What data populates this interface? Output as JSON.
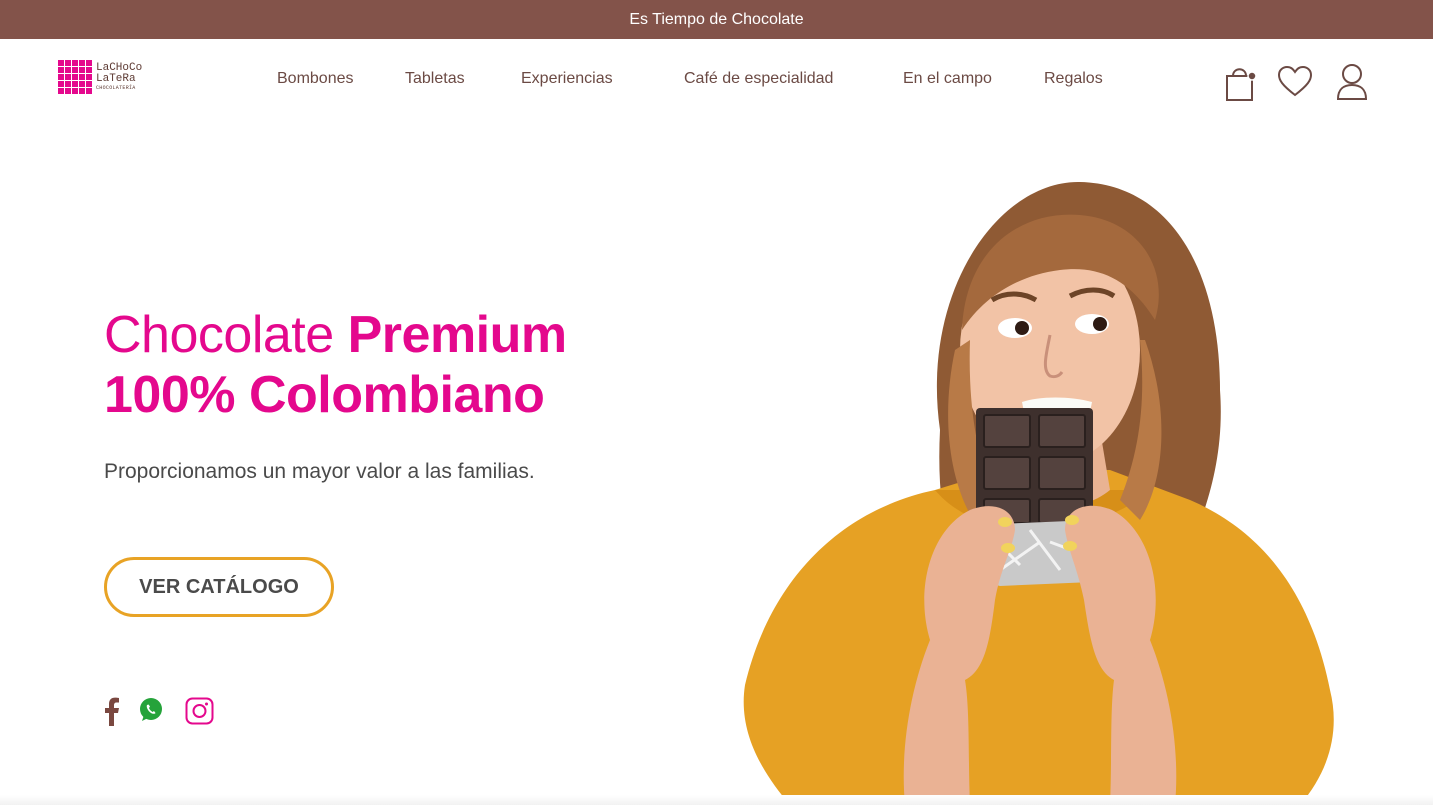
{
  "announcement": {
    "text": "Es Tiempo de Chocolate"
  },
  "logo": {
    "line1": "LaCHoCo",
    "line2": "LaTeRa",
    "line3": "CHOCOLATERÍA"
  },
  "nav": {
    "items": [
      {
        "label": "Bombones"
      },
      {
        "label": "Tabletas"
      },
      {
        "label": "Experiencias"
      },
      {
        "label": "Café de especialidad"
      },
      {
        "label": "En el campo"
      },
      {
        "label": "Regalos"
      }
    ]
  },
  "header_icons": [
    "shopping-bag-icon",
    "heart-icon",
    "user-icon"
  ],
  "hero": {
    "title_light": "Chocolate ",
    "title_bold_1": "Premium",
    "title_bold_2": "100% Colombiano",
    "subtitle": "Proporcionamos un mayor valor a las familias.",
    "cta_label": "VER CATÁLOGO"
  },
  "social": [
    "facebook-icon",
    "whatsapp-icon",
    "instagram-icon"
  ],
  "colors": {
    "topbar": "#83534a",
    "brand_pink": "#e4088d",
    "cta_border": "#e8a325",
    "nav_text": "#6b4a44",
    "whatsapp": "#25a33a",
    "shirt": "#e6a124"
  }
}
